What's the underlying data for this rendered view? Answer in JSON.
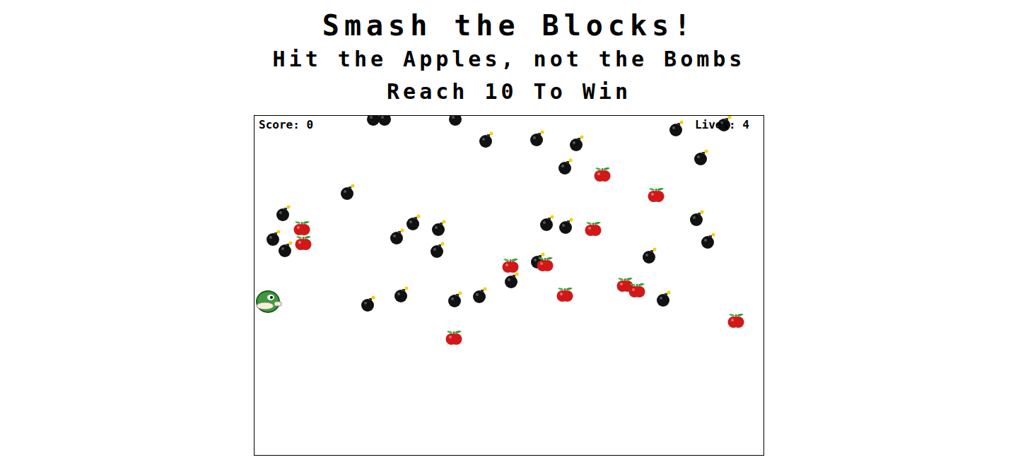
{
  "header": {
    "title": "Smash the Blocks!",
    "subtitle": "Hit the Apples, not the Bombs",
    "goal": "Reach 10 To Win"
  },
  "hud": {
    "score": "Score: 0",
    "lives": "Lives: 4"
  },
  "player": {
    "kind": "duck"
  },
  "sprites": [
    {
      "kind": "bomb"
    },
    {
      "kind": "bomb"
    },
    {
      "kind": "bomb"
    },
    {
      "kind": "bomb"
    },
    {
      "kind": "bomb"
    },
    {
      "kind": "bomb"
    },
    {
      "kind": "bomb"
    },
    {
      "kind": "bomb"
    },
    {
      "kind": "bomb"
    },
    {
      "kind": "bomb"
    },
    {
      "kind": "bomb"
    },
    {
      "kind": "bomb"
    },
    {
      "kind": "bomb"
    },
    {
      "kind": "bomb"
    },
    {
      "kind": "bomb"
    },
    {
      "kind": "bomb"
    },
    {
      "kind": "bomb"
    },
    {
      "kind": "bomb"
    },
    {
      "kind": "bomb"
    },
    {
      "kind": "bomb"
    },
    {
      "kind": "bomb"
    },
    {
      "kind": "bomb"
    },
    {
      "kind": "bomb"
    },
    {
      "kind": "bomb"
    },
    {
      "kind": "bomb"
    },
    {
      "kind": "bomb"
    },
    {
      "kind": "bomb"
    },
    {
      "kind": "bomb"
    },
    {
      "kind": "bomb"
    },
    {
      "kind": "bomb"
    },
    {
      "kind": "apple"
    },
    {
      "kind": "apple"
    },
    {
      "kind": "apple"
    },
    {
      "kind": "apple"
    },
    {
      "kind": "apple"
    },
    {
      "kind": "apple"
    },
    {
      "kind": "apple"
    },
    {
      "kind": "apple"
    },
    {
      "kind": "apple"
    },
    {
      "kind": "apple"
    },
    {
      "kind": "apple"
    },
    {
      "kind": "apple"
    }
  ]
}
